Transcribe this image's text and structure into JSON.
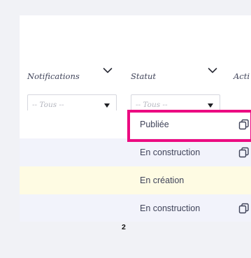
{
  "table": {
    "columns": {
      "notifications": "Notifications",
      "statut": "Statut",
      "actions": "Acti"
    },
    "filters": {
      "notifications_value": "-- Tous --",
      "statut_value": "-- Tous --"
    },
    "rows": [
      {
        "statut": "Publiée",
        "has_action": true,
        "background": "#ffffff"
      },
      {
        "statut": "En construction",
        "has_action": true,
        "background": "#f2f3fb"
      },
      {
        "statut": "En création",
        "has_action": false,
        "background": "#fefbe3"
      },
      {
        "statut": "En construction",
        "has_action": true,
        "background": "#f2f3fb"
      }
    ]
  },
  "pagination": {
    "page": "2"
  },
  "colors": {
    "highlight": "#ec0b81",
    "text": "#3f4359",
    "row_stripe": "#f2f3fb",
    "row_highlight": "#fefbe3"
  },
  "icons": {
    "sort": "chevron-down-icon",
    "action": "copy-icon"
  }
}
